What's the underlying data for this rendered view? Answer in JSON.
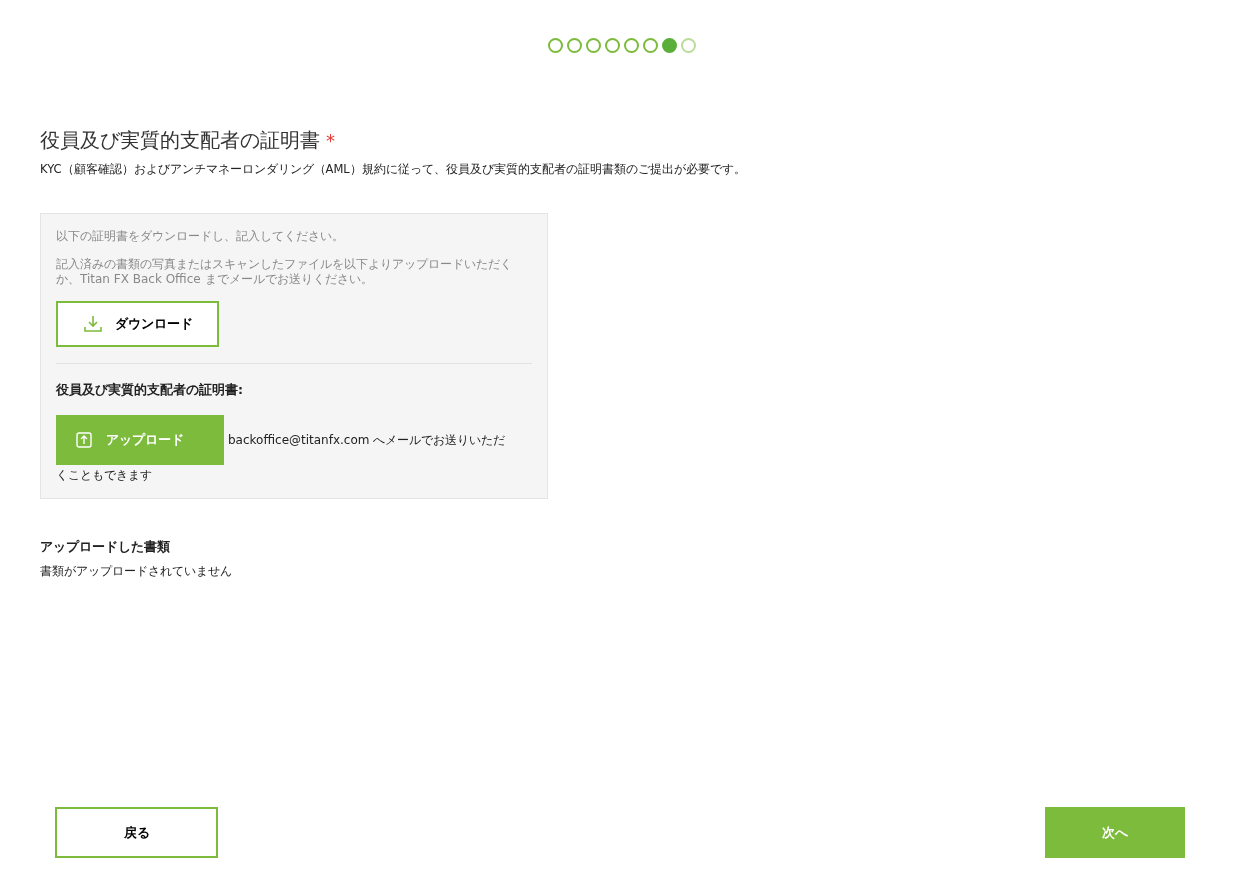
{
  "steps": [
    {
      "done": true,
      "selected": false
    },
    {
      "done": true,
      "selected": false
    },
    {
      "done": true,
      "selected": false
    },
    {
      "done": true,
      "selected": false
    },
    {
      "done": true,
      "selected": false
    },
    {
      "done": true,
      "selected": false
    },
    {
      "done": false,
      "selected": true
    },
    {
      "done": false,
      "selected": false
    }
  ],
  "heading": {
    "title": "役員及び実質的支配者の証明書",
    "required_mark": "*"
  },
  "description": "KYC（顧客確認）およびアンチマネーロンダリング（AML）規約に従って、役員及び実質的支配者の証明書類のご提出が必要です。",
  "panel": {
    "instruction": "以下の証明書をダウンロードし、記入してください。",
    "note": "記入済みの書類の写真またはスキャンしたファイルを以下よりアップロードいただくか、Titan FX Back Office までメールでお送りください。",
    "download_button": "ダウンロード",
    "upload_label": "役員及び実質的支配者の証明書:",
    "upload_button": "アップロード",
    "email_note": [
      "backoffice@titanfx.com へメールでお送りいただ",
      "くこともできます"
    ]
  },
  "uploaded": {
    "title": "アップロードした書類",
    "empty": "書類がアップロードされていません"
  },
  "footer": {
    "back": "戻る",
    "next": "次へ"
  }
}
